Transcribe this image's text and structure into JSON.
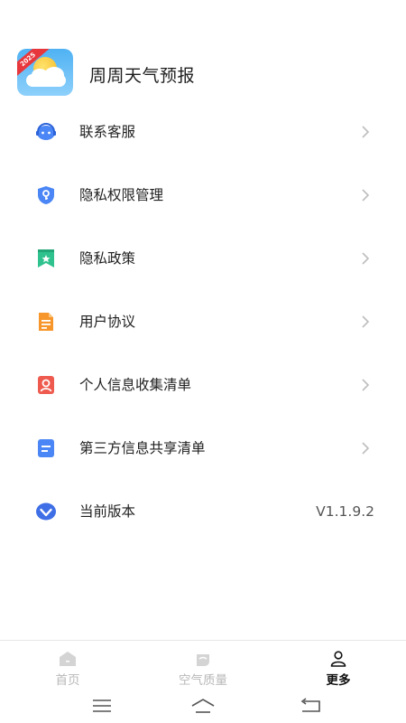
{
  "app": {
    "title": "周周天气预报",
    "logo_badge": "2025"
  },
  "menu": {
    "items": [
      {
        "label": "联系客服",
        "icon": "customer-service-icon"
      },
      {
        "label": "隐私权限管理",
        "icon": "shield-key-icon"
      },
      {
        "label": "隐私政策",
        "icon": "bookmark-star-icon"
      },
      {
        "label": "用户协议",
        "icon": "document-icon"
      },
      {
        "label": "个人信息收集清单",
        "icon": "person-card-icon"
      },
      {
        "label": "第三方信息共享清单",
        "icon": "list-document-icon"
      },
      {
        "label": "当前版本",
        "icon": "version-check-icon",
        "value": "V1.1.9.2"
      }
    ]
  },
  "bottom_nav": {
    "tabs": [
      {
        "label": "首页",
        "icon": "home-icon",
        "active": false
      },
      {
        "label": "空气质量",
        "icon": "air-quality-icon",
        "active": false
      },
      {
        "label": "更多",
        "icon": "user-icon",
        "active": true
      }
    ]
  },
  "colors": {
    "blue": "#4a86f5",
    "orange": "#f7962b",
    "red": "#ef5a4f",
    "green": "#2fc28e",
    "inactive": "#b8b8b8"
  }
}
